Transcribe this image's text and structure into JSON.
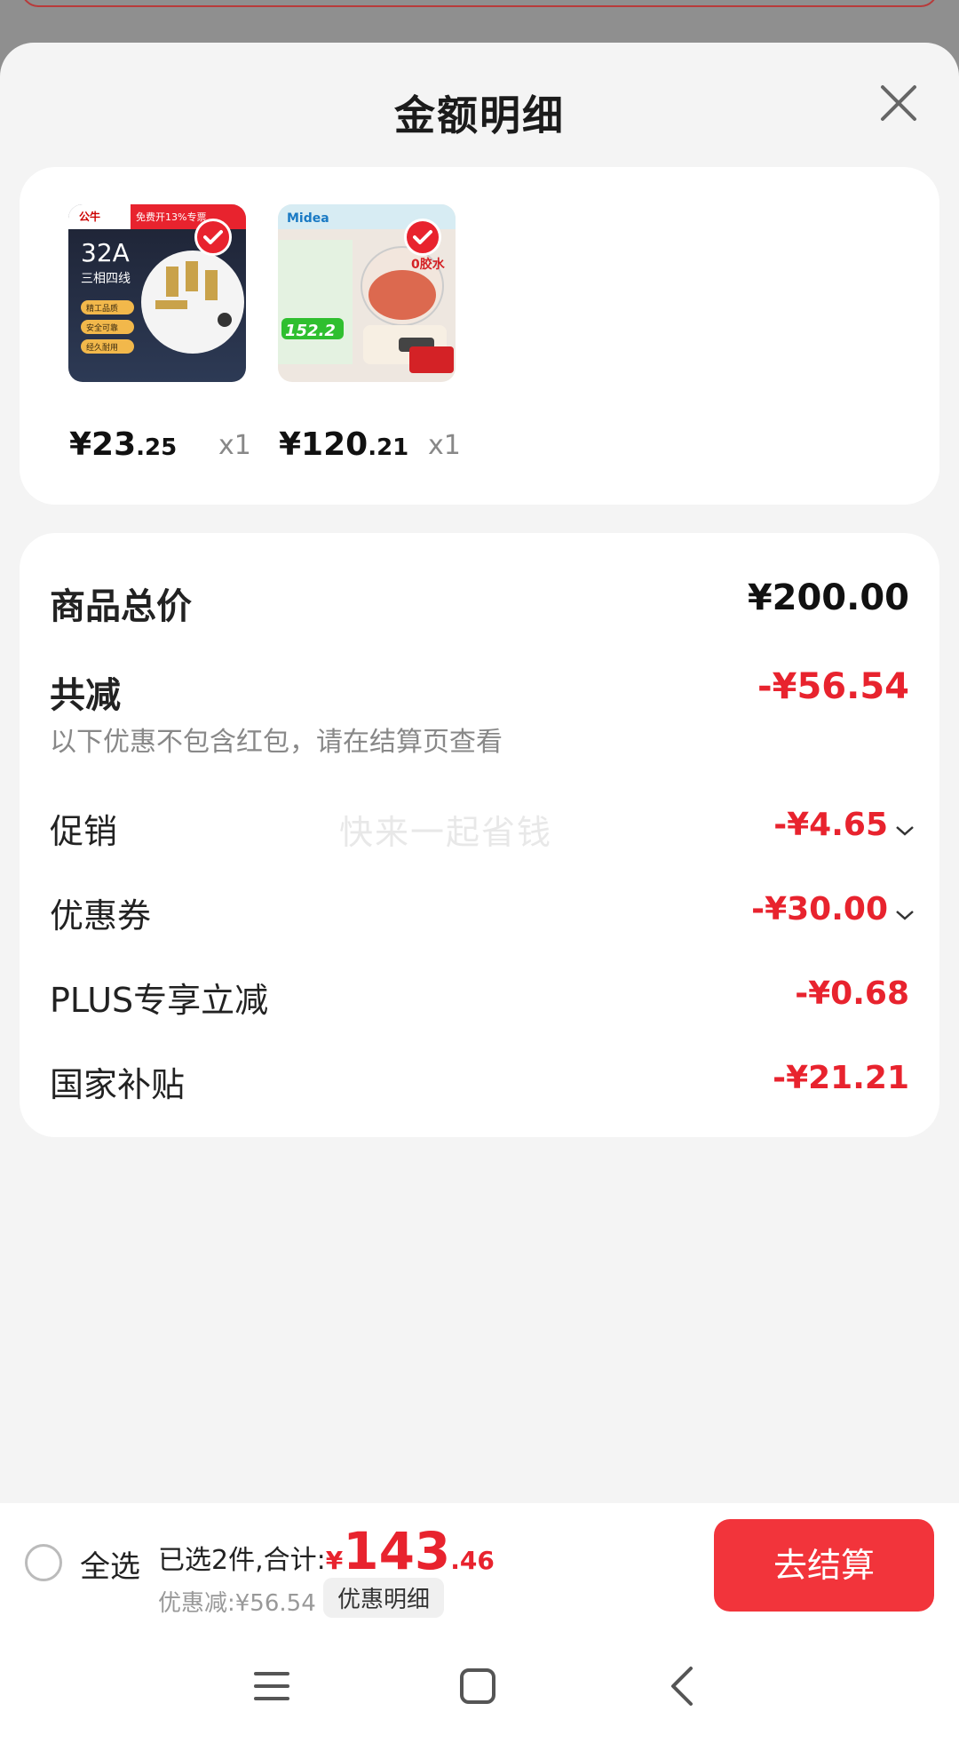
{
  "sheet": {
    "title": "金额明细"
  },
  "products": [
    {
      "price_main": "¥23",
      "price_decimal": ".25",
      "qty": "x1",
      "thumb": {
        "brand": "公牛",
        "tag": "免费开13%专票",
        "rating": "32A",
        "spec": "三相四线",
        "chips": [
          "精工品质",
          "安全可靠",
          "经久耐用"
        ]
      }
    },
    {
      "price_main": "¥120",
      "price_decimal": ".21",
      "qty": "x1",
      "thumb": {
        "brand": "Midea",
        "price_tag": "152.2",
        "badge": "0胶水"
      }
    }
  ],
  "summary": {
    "total_label": "商品总价",
    "total_value": "¥200.00",
    "reduction_label": "共减",
    "reduction_value": "-¥56.54",
    "note": "以下优惠不包含红包，请在结算页查看",
    "watermark": "快来一起省钱",
    "items": [
      {
        "label": "促销",
        "value": "-¥4.65",
        "expandable": true
      },
      {
        "label": "优惠券",
        "value": "-¥30.00",
        "expandable": true
      },
      {
        "label": "PLUS专享立减",
        "value": "-¥0.68",
        "expandable": false
      },
      {
        "label": "国家补贴",
        "value": "-¥21.21",
        "expandable": false
      }
    ]
  },
  "bottom": {
    "select_all": "全选",
    "selected_text": "已选2件,合计:",
    "currency": "¥",
    "total_int": "143",
    "total_dec": ".46",
    "discount_text": "优惠减:¥56.54",
    "detail_chip": "优惠明细",
    "checkout": "去结算"
  },
  "colors": {
    "accent": "#e8232e",
    "checkout_bg": "#f2343b",
    "sheet_bg": "#f4f4f4"
  },
  "icons": [
    "close-icon",
    "check-icon",
    "chevron-down-icon",
    "menu-icon",
    "home-square-icon",
    "back-icon"
  ]
}
